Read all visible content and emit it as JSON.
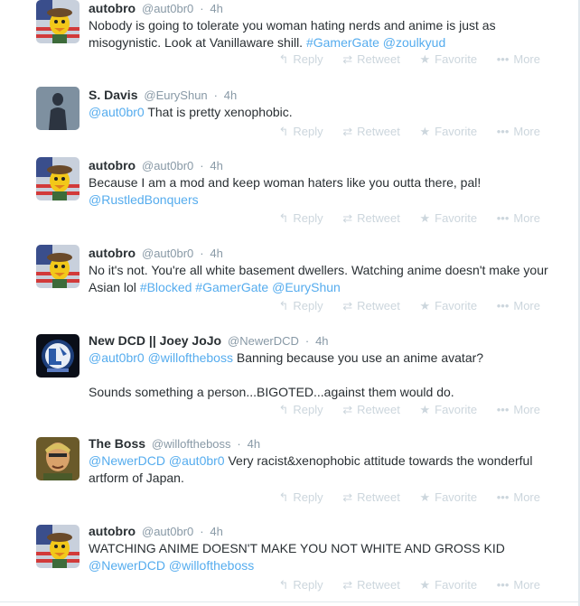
{
  "tweets": [
    {
      "fullname": "autobro",
      "username": "@aut0br0",
      "time": "4h",
      "avatar": "bird-flag",
      "text_parts": [
        {
          "t": "Nobody is going to tolerate you woman hating nerds and anime is just as misogynistic. Look at Vanillaware shill. ",
          "link": false
        },
        {
          "t": "#GamerGate",
          "link": true
        },
        {
          "t": " ",
          "link": false
        },
        {
          "t": "@zoulkyud",
          "link": true
        }
      ]
    },
    {
      "fullname": "S. Davis",
      "username": "@EuryShun",
      "time": "4h",
      "avatar": "silhouette",
      "text_parts": [
        {
          "t": "@aut0br0",
          "link": true
        },
        {
          "t": " That is pretty xenophobic.",
          "link": false
        }
      ]
    },
    {
      "fullname": "autobro",
      "username": "@aut0br0",
      "time": "4h",
      "avatar": "bird-flag",
      "text_parts": [
        {
          "t": "Because I am a mod and keep woman haters like you outta there, pal!\n",
          "link": false
        },
        {
          "t": "@RustledBonquers",
          "link": true
        }
      ]
    },
    {
      "fullname": "autobro",
      "username": "@aut0br0",
      "time": "4h",
      "avatar": "bird-flag",
      "text_parts": [
        {
          "t": "No it's not. You're all white basement dwellers. Watching anime doesn't make your Asian lol ",
          "link": false
        },
        {
          "t": "#Blocked",
          "link": true
        },
        {
          "t": " ",
          "link": false
        },
        {
          "t": "#GamerGate",
          "link": true
        },
        {
          "t": " ",
          "link": false
        },
        {
          "t": "@EuryShun",
          "link": true
        }
      ]
    },
    {
      "fullname": "New DCD || Joey JoJo",
      "username": "@NewerDCD",
      "time": "4h",
      "avatar": "emblem",
      "text_parts": [
        {
          "t": "@aut0br0",
          "link": true
        },
        {
          "t": " ",
          "link": false
        },
        {
          "t": "@willoftheboss",
          "link": true
        },
        {
          "t": " Banning because you use an anime avatar?\n\nSounds something a person...BIGOTED...against them would do.",
          "link": false
        }
      ]
    },
    {
      "fullname": "The Boss",
      "username": "@willoftheboss",
      "time": "4h",
      "avatar": "face",
      "text_parts": [
        {
          "t": "@NewerDCD",
          "link": true
        },
        {
          "t": " ",
          "link": false
        },
        {
          "t": "@aut0br0",
          "link": true
        },
        {
          "t": " Very racist&xenophobic attitude towards the wonderful artform of Japan.",
          "link": false
        }
      ]
    },
    {
      "fullname": "autobro",
      "username": "@aut0br0",
      "time": "4h",
      "avatar": "bird-flag",
      "text_parts": [
        {
          "t": "WATCHING ANIME DOESN'T MAKE YOU NOT WHITE AND GROSS KID\n",
          "link": false
        },
        {
          "t": "@NewerDCD",
          "link": true
        },
        {
          "t": " ",
          "link": false
        },
        {
          "t": "@willoftheboss",
          "link": true
        }
      ]
    }
  ],
  "actions": {
    "reply": "Reply",
    "retweet": "Retweet",
    "favorite": "Favorite",
    "more": "More"
  },
  "separator": "·",
  "colors": {
    "link": "#55acee",
    "muted": "#8899a6",
    "action": "#ccd6dd",
    "border": "#e1e8ed"
  }
}
